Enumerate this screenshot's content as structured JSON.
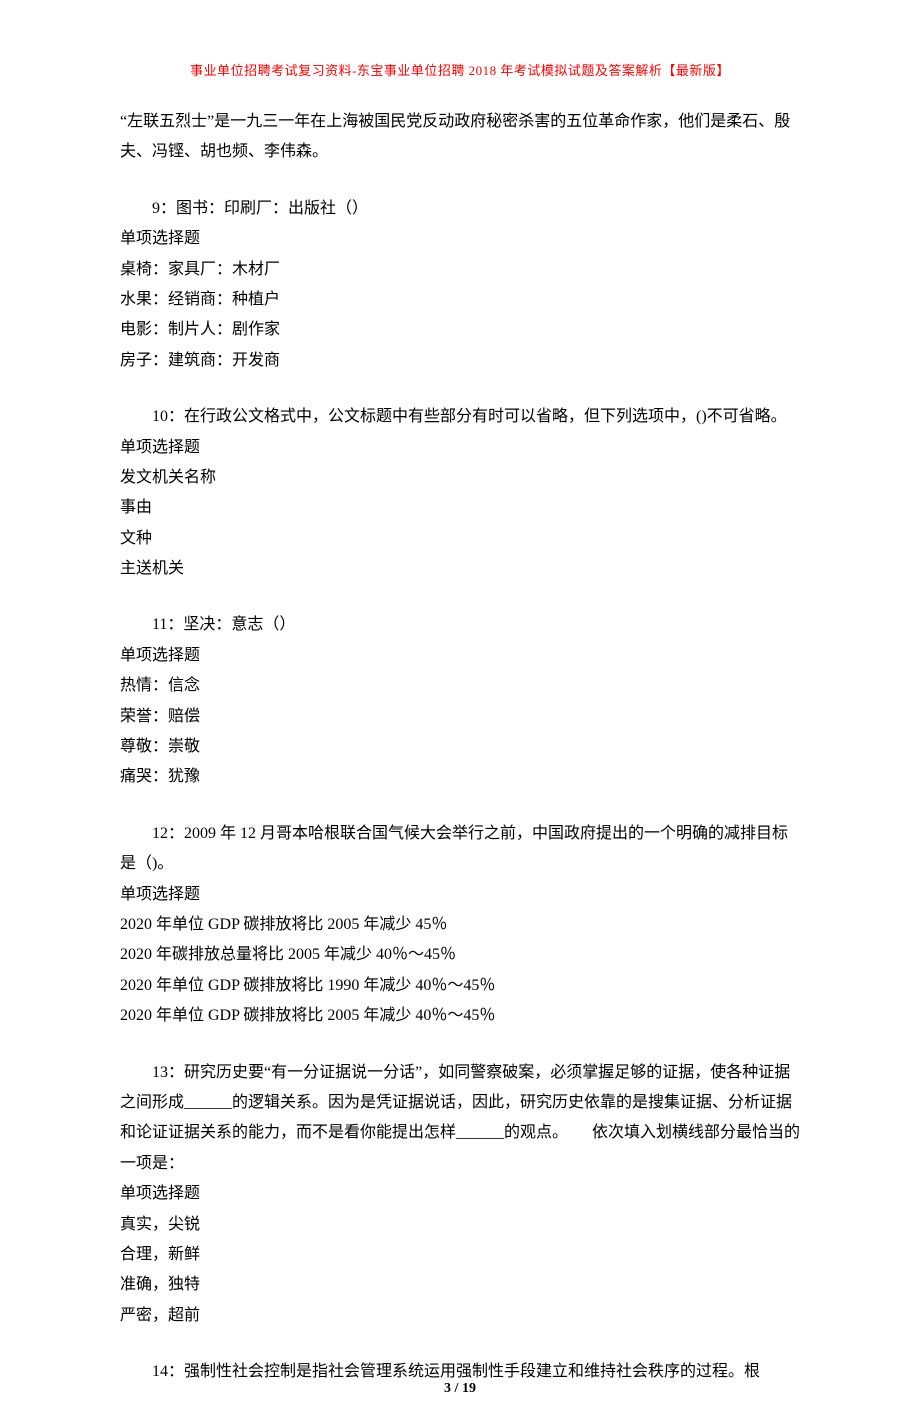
{
  "header": "事业单位招聘考试复习资料-东宝事业单位招聘 2018 年考试模拟试题及答案解析【最新版】",
  "intro": "“左联五烈士”是一九三一年在上海被国民党反动政府秘密杀害的五位革命作家，他们是柔石、殷夫、冯铿、胡也频、李伟森。",
  "questions": [
    {
      "num": "9：",
      "stem": "图书：印刷厂：出版社（）",
      "type": "单项选择题",
      "options": [
        "桌椅：家具厂：木材厂",
        "水果：经销商：种植户",
        "电影：制片人：剧作家",
        "房子：建筑商：开发商"
      ]
    },
    {
      "num": "10：",
      "stem": "在行政公文格式中，公文标题中有些部分有时可以省略，但下列选项中，()不可省略。",
      "type": "单项选择题",
      "options": [
        "发文机关名称",
        "事由",
        "文种",
        "主送机关"
      ]
    },
    {
      "num": "11：",
      "stem": "坚决：意志（）",
      "type": "单项选择题",
      "options": [
        "热情：信念",
        "荣誉：赔偿",
        "尊敬：崇敬",
        "痛哭：犹豫"
      ]
    },
    {
      "num": "12：",
      "stem": "2009 年 12 月哥本哈根联合国气候大会举行之前，中国政府提出的一个明确的减排目标是（)。",
      "type": "单项选择题",
      "options": [
        "2020 年单位 GDP 碳排放将比 2005 年减少 45％",
        "2020 年碳排放总量将比 2005 年减少 40％～45％",
        "2020 年单位 GDP 碳排放将比 1990 年减少 40％～45％",
        "2020 年单位 GDP 碳排放将比 2005 年减少 40％～45％"
      ]
    },
    {
      "num": "13：",
      "stem": "研究历史要“有一分证据说一分话”，如同警察破案，必须掌握足够的证据，使各种证据之间形成______的逻辑关系。因为是凭证据说话，因此，研究历史依靠的是搜集证据、分析证据和论证证据关系的能力，而不是看你能提出怎样______的观点。　　依次填入划横线部分最恰当的一项是：",
      "type": "单项选择题",
      "options": [
        "真实，尖锐",
        "合理，新鲜",
        "准确，独特",
        "严密，超前"
      ]
    },
    {
      "num": "14：",
      "stem": "强制性社会控制是指社会管理系统运用强制性手段建立和维持社会秩序的过程。根",
      "type": "",
      "options": []
    }
  ],
  "footer": {
    "current": "3",
    "sep": " / ",
    "total": "19"
  }
}
